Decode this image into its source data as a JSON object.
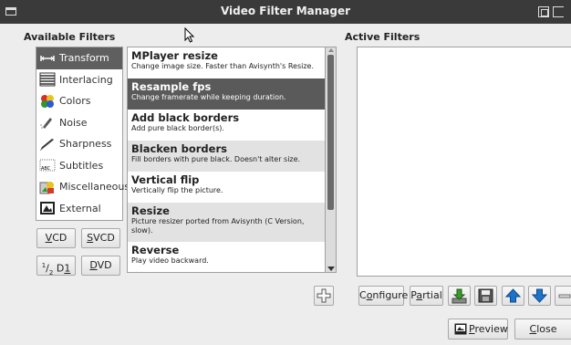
{
  "window": {
    "title": "Video Filter Manager"
  },
  "available": {
    "label": "Available Filters"
  },
  "active": {
    "label": "Active Filters"
  },
  "categories": [
    {
      "label": "Transform",
      "icon": "transform-icon"
    },
    {
      "label": "Interlacing",
      "icon": "interlacing-icon"
    },
    {
      "label": "Colors",
      "icon": "colors-icon"
    },
    {
      "label": "Noise",
      "icon": "noise-icon"
    },
    {
      "label": "Sharpness",
      "icon": "sharpness-icon"
    },
    {
      "label": "Subtitles",
      "icon": "subtitles-icon"
    },
    {
      "label": "Miscellaneous",
      "icon": "miscellaneous-icon"
    },
    {
      "label": "External",
      "icon": "external-icon"
    }
  ],
  "filters": [
    {
      "name": "MPlayer resize",
      "desc": "Change image size. Faster than Avisynth's Resize."
    },
    {
      "name": "Resample fps",
      "desc": "Change framerate while keeping duration."
    },
    {
      "name": "Add black borders",
      "desc": "Add pure black border(s)."
    },
    {
      "name": "Blacken borders",
      "desc": "Fill borders with pure black. Doesn't alter size."
    },
    {
      "name": "Vertical flip",
      "desc": "Vertically flip the picture."
    },
    {
      "name": "Resize",
      "desc": "Picture resizer ported from Avisynth (C Version, slow)."
    },
    {
      "name": "Reverse",
      "desc": "Play video backward."
    }
  ],
  "presets": {
    "vcd": {
      "key": "V",
      "rest": "CD"
    },
    "svcd": {
      "key": "S",
      "rest": "VCD"
    },
    "half_d1": {
      "num": "1",
      "den": "2",
      "pre": " D",
      "key": "1"
    },
    "dvd": {
      "key": "D",
      "rest": "VD"
    }
  },
  "buttons": {
    "configure": {
      "pre": "C",
      "key": "o",
      "rest": "nfigure"
    },
    "partial": {
      "pre": "P",
      "key": "a",
      "rest": "rtial"
    },
    "preview": {
      "key": "P",
      "rest": "review"
    },
    "close": {
      "key": "C",
      "rest": "lose"
    }
  },
  "colors": {
    "titlebar": "#3a3a3a",
    "selected": "#5a5a5a",
    "arrow_blue": "#1e73c8",
    "download_green": "#3a9a2a"
  }
}
